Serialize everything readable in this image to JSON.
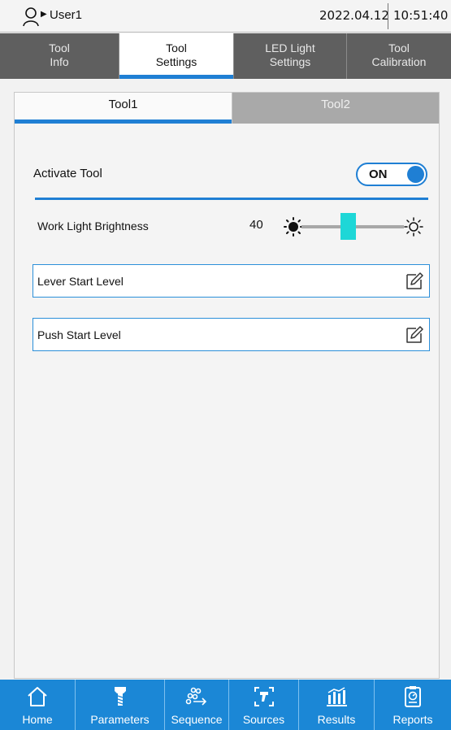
{
  "status": {
    "user": "User1",
    "date": "2022.04.12",
    "time": "10:51:40"
  },
  "tabs": [
    {
      "line1": "Tool",
      "line2": "Info",
      "active": false
    },
    {
      "line1": "Tool",
      "line2": "Settings",
      "active": true
    },
    {
      "line1": "LED Light",
      "line2": "Settings",
      "active": false
    },
    {
      "line1": "Tool",
      "line2": "Calibration",
      "active": false
    }
  ],
  "subtabs": {
    "tool1": "Tool1",
    "tool2": "Tool2",
    "active": "Tool1"
  },
  "settings": {
    "activate_label": "Activate Tool",
    "activate_state": "ON",
    "brightness_label": "Work Light Brightness",
    "brightness_value": "40",
    "brightness_fraction": 0.4,
    "lever_label": "Lever Start Level",
    "push_label": "Push Start Level"
  },
  "nav": {
    "home": "Home",
    "parameters": "Parameters",
    "sequence": "Sequence",
    "sources": "Sources",
    "results": "Results",
    "reports": "Reports"
  },
  "icons": {
    "user": "user-icon",
    "edit": "pencil-edit-icon",
    "sun_dark": "sun-filled-icon",
    "sun_light": "sun-outline-icon"
  },
  "colors": {
    "accent": "#1f7fd4",
    "nav_bg": "#1b87d6",
    "slider_thumb": "#1ed7d7",
    "tabbar_bg": "#5f5f5f"
  }
}
